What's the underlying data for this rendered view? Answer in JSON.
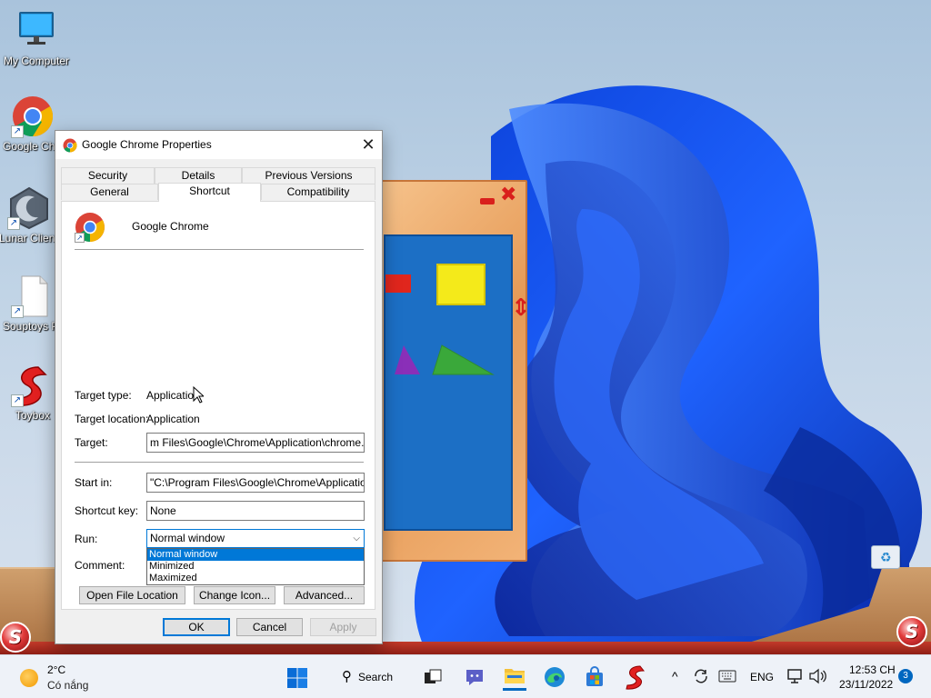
{
  "desktop": {
    "icons": [
      {
        "label": "My Computer",
        "icon": "monitor-icon"
      },
      {
        "label": "Google Chrome",
        "icon": "chrome-icon"
      },
      {
        "label": "Lunar Client",
        "icon": "lunar-icon"
      },
      {
        "label": "Souptoys Playsets",
        "icon": "file-icon"
      },
      {
        "label": "Toybox",
        "icon": "toybox-icon"
      }
    ]
  },
  "dialog": {
    "title": "Google Chrome Properties",
    "tabs_row1": [
      "Security",
      "Details",
      "Previous Versions"
    ],
    "tabs_row2": [
      "General",
      "Shortcut",
      "Compatibility"
    ],
    "active_tab": "Shortcut",
    "app_name": "Google Chrome",
    "fields": {
      "target_type_label": "Target type:",
      "target_type_value": "Application",
      "target_location_label": "Target location:",
      "target_location_value": "Application",
      "target_label": "Target:",
      "target_value": "m Files\\Google\\Chrome\\Application\\chrome.exe\"",
      "start_in_label": "Start in:",
      "start_in_value": "\"C:\\Program Files\\Google\\Chrome\\Application\"",
      "shortcut_key_label": "Shortcut key:",
      "shortcut_key_value": "None",
      "run_label": "Run:",
      "run_value": "Normal window",
      "comment_label": "Comment:"
    },
    "run_options": [
      "Normal window",
      "Minimized",
      "Maximized"
    ],
    "buttons": {
      "open_file_location": "Open File Location",
      "change_icon": "Change Icon...",
      "advanced": "Advanced...",
      "ok": "OK",
      "cancel": "Cancel",
      "apply": "Apply"
    }
  },
  "taskbar": {
    "weather_temp": "2°C",
    "weather_desc": "Có nắng",
    "search_label": "Search",
    "language": "ENG",
    "time": "12:53 CH",
    "date": "23/11/2022",
    "notification_count": "3"
  },
  "colors": {
    "accent": "#0078d7",
    "toy_red": "#d9201c",
    "toy_blue": "#1c6fc5"
  }
}
